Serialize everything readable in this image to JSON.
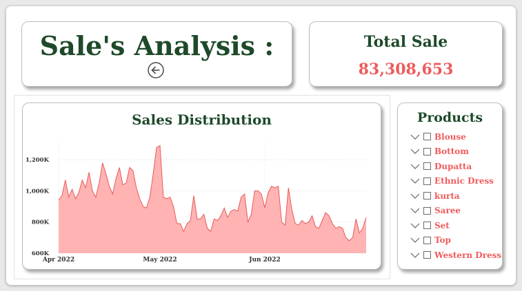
{
  "header": {
    "title": "Sale's Analysis :",
    "back_icon": "arrow-left-circle-icon"
  },
  "total": {
    "label": "Total Sale",
    "value": "83,308,653",
    "value_color": "#ef5b5b"
  },
  "products": {
    "title": "Products",
    "items": [
      {
        "label": "Blouse"
      },
      {
        "label": "Bottom"
      },
      {
        "label": "Dupatta"
      },
      {
        "label": "Ethnic Dress"
      },
      {
        "label": "kurta"
      },
      {
        "label": "Saree"
      },
      {
        "label": "Set"
      },
      {
        "label": "Top"
      },
      {
        "label": "Western Dress"
      }
    ]
  },
  "colors": {
    "heading": "#1e4a2a",
    "accent": "#ef5b5b",
    "area_fill": "#ffb3b3",
    "area_line": "#e85a5a"
  },
  "chart_data": {
    "type": "area",
    "title": "Sales Distribution",
    "xlabel": "",
    "ylabel": "",
    "x_ticks": [
      "Apr 2022",
      "May 2022",
      "Jun 2022"
    ],
    "x_tick_positions_day": [
      0,
      30,
      61
    ],
    "y_ticks": [
      "600K",
      "800K",
      "1,000K",
      "1,200K"
    ],
    "y_tick_values": [
      600000,
      800000,
      1000000,
      1200000
    ],
    "ylim": [
      600000,
      1320000
    ],
    "x_range_days": [
      0,
      91
    ],
    "grid": true,
    "series": [
      {
        "x_day": [
          0,
          1,
          2,
          3,
          4,
          5,
          6,
          7,
          8,
          9,
          10,
          11,
          12,
          13,
          14,
          15,
          16,
          17,
          18,
          19,
          20,
          21,
          22,
          23,
          24,
          25,
          26,
          27,
          28,
          29,
          30,
          31,
          32,
          33,
          34,
          35,
          36,
          37,
          38,
          39,
          40,
          41,
          42,
          43,
          44,
          45,
          46,
          47,
          48,
          49,
          50,
          51,
          52,
          53,
          54,
          55,
          56,
          57,
          58,
          59,
          60,
          61,
          62,
          63,
          64,
          65,
          66,
          67,
          68,
          69,
          70,
          71,
          72,
          73,
          74,
          75,
          76,
          77,
          78,
          79,
          80,
          81,
          82,
          83,
          84,
          85,
          86,
          87,
          88,
          89,
          90,
          91
        ],
        "values": [
          940000,
          970000,
          1070000,
          960000,
          1010000,
          950000,
          990000,
          1070000,
          1020000,
          1120000,
          1000000,
          960000,
          1050000,
          1180000,
          1110000,
          1030000,
          980000,
          1080000,
          1150000,
          1040000,
          1050000,
          1150000,
          1130000,
          1020000,
          950000,
          900000,
          890000,
          960000,
          1110000,
          1280000,
          1290000,
          960000,
          950000,
          960000,
          900000,
          790000,
          790000,
          740000,
          790000,
          810000,
          970000,
          820000,
          820000,
          850000,
          760000,
          740000,
          820000,
          810000,
          840000,
          890000,
          830000,
          870000,
          880000,
          870000,
          960000,
          980000,
          800000,
          850000,
          1000000,
          1000000,
          980000,
          890000,
          990000,
          1030000,
          1020000,
          1030000,
          800000,
          780000,
          1020000,
          880000,
          790000,
          780000,
          810000,
          790000,
          800000,
          840000,
          770000,
          760000,
          810000,
          860000,
          840000,
          790000,
          760000,
          770000,
          760000,
          700000,
          680000,
          700000,
          820000,
          730000,
          760000,
          830000
        ]
      }
    ]
  }
}
